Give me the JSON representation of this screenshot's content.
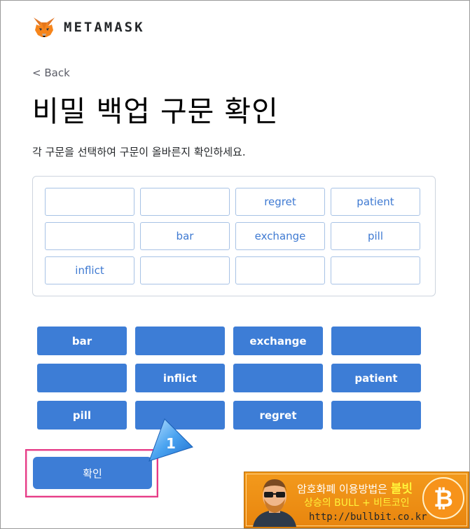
{
  "header": {
    "brand": "METAMASK",
    "logo_icon": "metamask-fox-icon"
  },
  "nav": {
    "back_label": "< Back"
  },
  "page": {
    "title": "비밀 백업 구문 확인",
    "instructions": "각 구문을 선택하여 구문이 올바른지 확인하세요."
  },
  "selected_slots": [
    "",
    "",
    "regret",
    "patient",
    "",
    "bar",
    "exchange",
    "pill",
    "inflict",
    "",
    "",
    ""
  ],
  "word_buttons": [
    "bar",
    "",
    "exchange",
    "",
    "",
    "inflict",
    "",
    "patient",
    "pill",
    "",
    "regret",
    ""
  ],
  "confirm": {
    "label": "확인"
  },
  "callout": {
    "number": "1"
  },
  "banner": {
    "line1": "암호화폐 이용방법은",
    "line1_highlight": "불빗",
    "line2": "상승의 BULL + 비트코인",
    "url": "http://bullbit.co.kr",
    "bitcoin_glyph": "₿"
  },
  "colors": {
    "accent": "#3d7dd6",
    "highlight": "#e63a86",
    "banner": "#f39a1c"
  }
}
